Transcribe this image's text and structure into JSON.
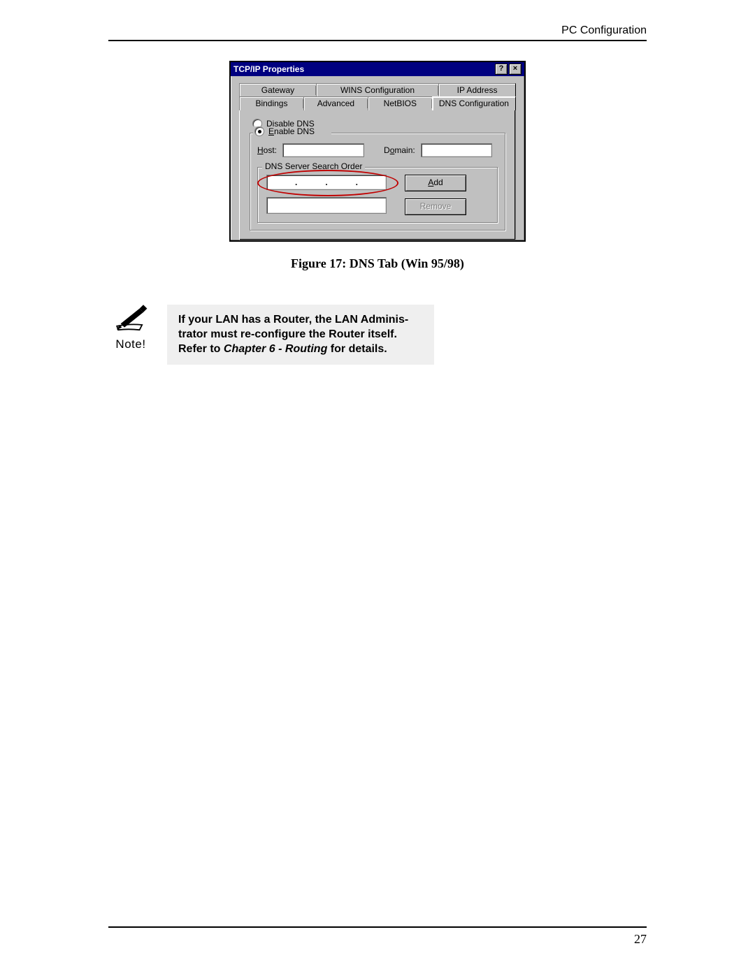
{
  "header": {
    "running": "PC Configuration"
  },
  "dialog": {
    "title": "TCP/IP Properties",
    "tabs_row1": [
      "Gateway",
      "WINS Configuration",
      "IP Address"
    ],
    "tabs_row2": [
      "Bindings",
      "Advanced",
      "NetBIOS",
      "DNS Configuration"
    ],
    "radio_disable": "Disable DNS",
    "radio_enable": "Enable DNS",
    "host_label": "Host:",
    "domain_label": "Domain:",
    "group_label": "DNS Server Search Order",
    "btn_add": "Add",
    "btn_remove": "Remove"
  },
  "caption": "Figure 17: DNS Tab (Win 95/98)",
  "note": {
    "icon_label": "Note!",
    "line1": "If your LAN has a Router, the LAN Adminis-",
    "line2": "trator must re-configure the Router itself.",
    "line3a": "Refer to ",
    "chapter": "Chapter 6 - Routing",
    "line3b": " for details."
  },
  "page_number": "27"
}
